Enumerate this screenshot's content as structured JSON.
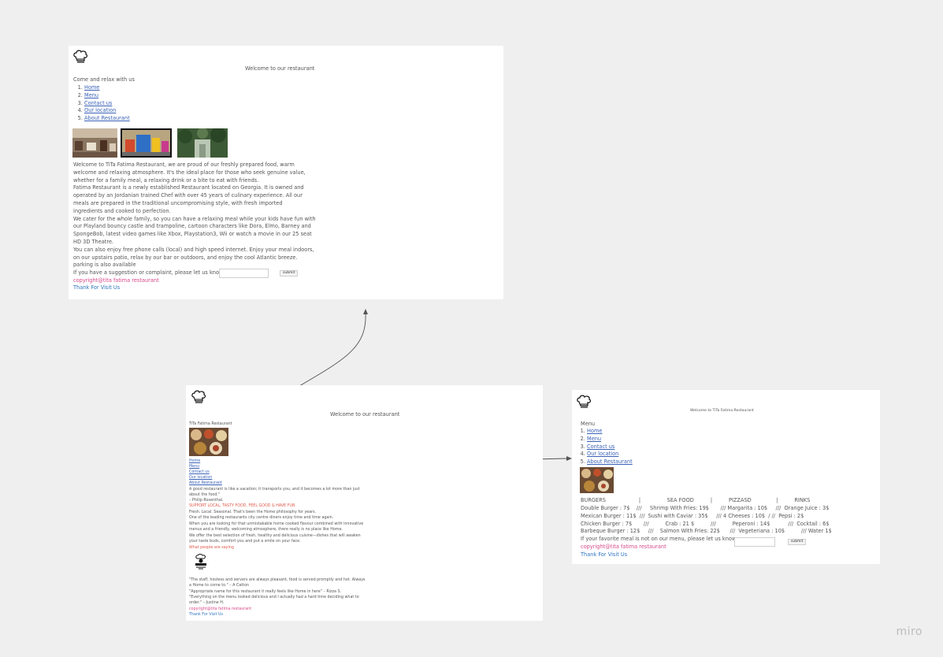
{
  "frame1": {
    "title": "Welcome to our restaurant",
    "intro": "Come and relax with us",
    "nav": [
      "Home",
      "Menu",
      "Contact us",
      "Our location",
      "About Restaurant"
    ],
    "paragraph_lines": [
      "Welcome to TiTa Fatima Restaurant, we are proud of our freshly prepared food, warm",
      "welcome and relaxing atmosphere. It's the ideal place for those who seek genuine value,",
      "whether for a family meal, a relaxing drink or a bite to eat with friends.",
      "Fatima Restaurant is a newly established Restaurant located on Georgia. It is owned and",
      "operated by an Jordanian trained Chef with over 45 years of culinary experience. All our",
      "meals are prepared in the traditional uncompromising style, with fresh imported",
      "ingredients and cooked to perfection.",
      "We cater for the whole family, so you can have a relaxing meal while your kids have fun with",
      "our Playland bouncy castle and trampoline, cartoon characters like Dora, Elmo, Barney and",
      "SpongeBob, latest video games like Xbox, Playstation3, Wii or watch a movie in our 25 seat",
      "HD 3D Theatre.",
      "You can also enjoy free phone calls (local) and high speed internet. Enjoy your meal indoors,",
      "on our upstairs patio, relax by our bar or outdoors, and enjoy the cool Atlantic breeze.",
      "parking is also available"
    ],
    "suggestion_label": "If you have a suggestion or complaint, please let us know:",
    "submit": "submit",
    "copyright": "copyright@tita fatima restaurant",
    "thanks": "Thank For Visit Us"
  },
  "frame2": {
    "title": "Welcome to our restaurant",
    "subtitle": "TiTa Fatima Restaurant",
    "nav": [
      "Home",
      "Menu",
      "Contact us",
      "Our location",
      "About Restaurant"
    ],
    "quote_lines": [
      "A good restaurant is like a vacation; it transports you, and it becomes a lot more than just",
      "about the food.\"",
      "– Philip Rosenthal."
    ],
    "slogan": "SUPPORT LOCAL, TASTY FOOD, FEEL GOOD & HAVE FUN",
    "body_lines": [
      "Fresh. Local. Seasonal. That's been the Home philosophy for years.",
      "One of the leading restaurants city centre diners enjoy time and time again.",
      "When you are looking for that unmistakable home cooked flavour combined with innovative",
      "menus and a friendly, welcoming atmosphere, there really is no place like Home.",
      "We offer the best selection of fresh, healthy and delicious cuisine—dishes that will awaken",
      "your taste buds, comfort you and put a smile on your face."
    ],
    "reviews_heading": "What people are saying",
    "review_lines": [
      "\"The staff, hostess and servers are always pleasant, food is served promptly and hot. Always",
      "a Home to come to.\" – A Catton",
      "\"Appropriate name for this restaurant it really feels like Home in here\" – Rizza S.",
      "\"Everything on the menu looked delicious and I actually had a hard time deciding what to",
      "order.\" – Justine H."
    ],
    "copyright": "copyright@tita fatima restaurant",
    "thanks": "Thank For Visit Us"
  },
  "frame3": {
    "title": "Welcome to TiTa Fatima Restaurant",
    "heading": "Menu",
    "nav": [
      "Home",
      "Menu",
      "Contact us",
      "Our location",
      "About Restaurant"
    ],
    "categories_line": "BURGERS                    |                SEA FOOD          |          PIZZASD               |          RINKS",
    "menu_lines": [
      "Double Burger : 7$    ///     Shrimp With Fries: 19$       /// Margarita : 10$     ///  Orange Juice : 3$",
      "Mexican Burger : 11$  ///  Sushi with Caviar : 35$     /// 4 Cheeses : 10$  / //  Pepsi : 2$",
      "Chicken Burger : 7$       ///          Crab : 21 $          ///          Peperoni : 14$           ///  Cocktail : 6$",
      "Barbeque Burger : 12$     ///    Salmon With Fries: 22$      ///  Vegeteriana : 10$          /// Water 1$"
    ],
    "suggestion_label": "If your favorite meal is not on our menu, please let us know:",
    "submit": "submit",
    "copyright": "copyright@tita fatima restaurant",
    "thanks": "Thank For Visit Us"
  },
  "watermark": "miro"
}
